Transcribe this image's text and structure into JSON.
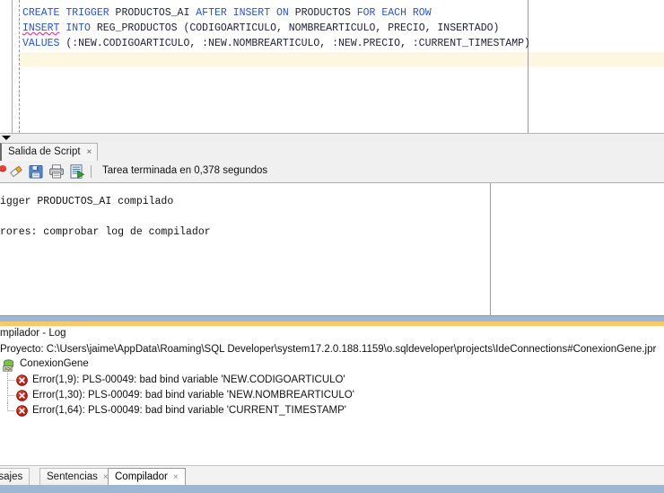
{
  "editor": {
    "name": "sql-worksheet",
    "lines": [
      [
        {
          "t": "CREATE",
          "k": true
        },
        {
          "t": " ",
          "k": false
        },
        {
          "t": "TRIGGER",
          "k": true
        },
        {
          "t": " PRODUCTOS_AI ",
          "k": false
        },
        {
          "t": "AFTER",
          "k": true
        },
        {
          "t": " ",
          "k": false
        },
        {
          "t": "INSERT",
          "k": true
        },
        {
          "t": " ",
          "k": false
        },
        {
          "t": "ON",
          "k": true
        },
        {
          "t": " PRODUCTOS ",
          "k": false
        },
        {
          "t": "FOR",
          "k": true
        },
        {
          "t": " ",
          "k": false
        },
        {
          "t": "EACH",
          "k": true
        },
        {
          "t": " ",
          "k": false
        },
        {
          "t": "ROW",
          "k": true
        }
      ],
      [
        {
          "t": "INSERT",
          "k": true,
          "squiggle": true
        },
        {
          "t": " ",
          "k": false
        },
        {
          "t": "INTO",
          "k": true
        },
        {
          "t": " REG_PRODUCTOS (CODIGOARTICULO, NOMBREARTICULO, PRECIO, INSERTADO)",
          "k": false
        }
      ],
      [
        {
          "t": "VALUES",
          "k": true
        },
        {
          "t": " (:NEW.CODIGOARTICULO, :NEW.NOMBREARTICULO, :NEW.PRECIO, :CURRENT_TIMESTAMP)",
          "k": false
        }
      ]
    ],
    "plain_text": "CREATE TRIGGER PRODUCTOS_AI AFTER INSERT ON PRODUCTOS FOR EACH ROW\nINSERT INTO REG_PRODUCTOS (CODIGOARTICULO, NOMBREARTICULO, PRECIO, INSERTADO)\nVALUES (:NEW.CODIGOARTICULO, :NEW.NOMBREARTICULO, :NEW.PRECIO, :CURRENT_TIMESTAMP)",
    "keyword_color": "#2a53c6",
    "identifier_color": "#22223a",
    "current_line_color": "#fdf6e0"
  },
  "script_panel": {
    "tab": {
      "label": "Salida de Script",
      "close": "×"
    },
    "toolbar": {
      "icons": [
        {
          "name": "clear-icon",
          "title": "Borrar"
        },
        {
          "name": "eraser-icon",
          "title": "Borrar todo"
        },
        {
          "name": "save-icon",
          "title": "Guardar"
        },
        {
          "name": "print-icon",
          "title": "Imprimir"
        },
        {
          "name": "run-script-icon",
          "title": "Ejecutar script"
        }
      ],
      "status": "Tarea terminada en 0,378 segundos"
    },
    "output_lines": [
      "igger PRODUCTOS_AI compilado",
      "",
      "rores: comprobar log de compilador"
    ]
  },
  "log_panel": {
    "title": "mpilador - Log",
    "project": "Proyecto: C:\\Users\\jaime\\AppData\\Roaming\\SQL Developer\\system17.2.0.188.1159\\o.sqldeveloper\\projects\\IdeConnections#ConexionGene.jpr",
    "connection": "ConexionGene",
    "errors": [
      "Error(1,9): PLS-00049: bad bind variable 'NEW.CODIGOARTICULO'",
      "Error(1,30): PLS-00049: bad bind variable 'NEW.NOMBREARTICULO'",
      "Error(1,64): PLS-00049: bad bind variable 'CURRENT_TIMESTAMP'"
    ],
    "error_icon_color": "#c4241c",
    "band_blue": "#9cb6d4",
    "band_amber": "#f6ca68"
  },
  "bottom_tabs": [
    {
      "label": "nsajes",
      "closable": false,
      "active": false
    },
    {
      "label": "Sentencias",
      "closable": true,
      "active": false
    },
    {
      "label": "Compilador",
      "closable": true,
      "active": true
    }
  ],
  "tab_close_glyph": "×",
  "statusbar": {
    "color": "#9cb6d4"
  }
}
